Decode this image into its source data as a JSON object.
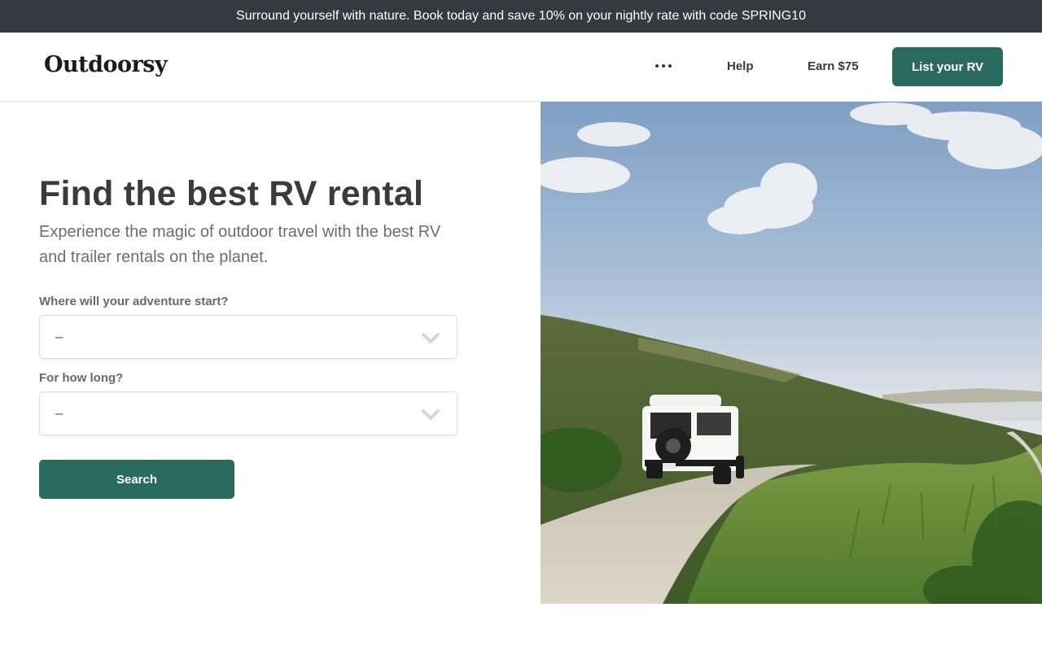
{
  "promo": {
    "text": "Surround yourself with nature. Book today and save 10% on your nightly rate with code SPRING10"
  },
  "header": {
    "logo": "Outdoorsy",
    "nav": {
      "more_icon": "more-horizontal-icon",
      "help": "Help",
      "earn": "Earn $75",
      "cta": "List your RV"
    }
  },
  "hero": {
    "title": "Find the best RV rental",
    "subtitle": "Experience the magic of outdoor travel with the best RV and trailer rentals on the planet.",
    "image_description": "White off-road SUV with roof box driving on a gravel road through green hills under a blue sky"
  },
  "search_form": {
    "start_label": "Where will your adventure start?",
    "start_value": "–",
    "length_label": "For how long?",
    "length_value": "–",
    "dropdown_icon": "chevron-down-icon",
    "submit": "Search"
  },
  "colors": {
    "promo_bg": "#343a3f",
    "brand_green": "#2b6a5f",
    "title_text": "#3b3b3b",
    "muted_text": "#6a6e73"
  }
}
